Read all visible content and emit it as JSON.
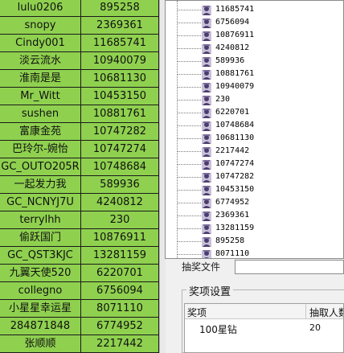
{
  "sheet": {
    "rows": [
      {
        "name": "lulu0206",
        "id": "895258"
      },
      {
        "name": "snopy",
        "id": "2369361"
      },
      {
        "name": "Cindy001",
        "id": "11685741"
      },
      {
        "name": "淡云流水",
        "id": "10940079"
      },
      {
        "name": "淮南是是",
        "id": "10681130"
      },
      {
        "name": "Mr_Witt",
        "id": "10453150"
      },
      {
        "name": "sushen",
        "id": "10881761"
      },
      {
        "name": "富康金苑",
        "id": "10747282"
      },
      {
        "name": "巴玲尔-婉怡",
        "id": "10747274"
      },
      {
        "name": "GC_OUTO205R",
        "id": "10748684"
      },
      {
        "name": "一起发力我",
        "id": "589936"
      },
      {
        "name": "GC_NCNYJ7U",
        "id": "4240812"
      },
      {
        "name": "terrylhh",
        "id": "230"
      },
      {
        "name": "偷跃国门",
        "id": "10876911"
      },
      {
        "name": "GC_QST3KJC",
        "id": "13281159"
      },
      {
        "name": "九翼天使520",
        "id": "6220701"
      },
      {
        "name": "collegno",
        "id": "6756094"
      },
      {
        "name": "小星星幸运星",
        "id": "8071110"
      },
      {
        "name": "284871848",
        "id": "6774952"
      },
      {
        "name": "张顺顺",
        "id": "2217442"
      }
    ]
  },
  "tree": {
    "items": [
      "11685741",
      "6756094",
      "10876911",
      "4240812",
      "589936",
      "10881761",
      "10940079",
      "230",
      "6220701",
      "10748684",
      "10681130",
      "2217442",
      "10747274",
      "10747282",
      "10453150",
      "6774952",
      "2369361",
      "13281159",
      "895258",
      "8071110"
    ],
    "icon": "user-icon"
  },
  "form": {
    "field_label": "抽奖文件"
  },
  "prize_group": {
    "title": "奖项设置",
    "columns": [
      "奖项",
      "抽取人数"
    ],
    "rows": [
      {
        "prize": "100星钻",
        "count": "20"
      }
    ]
  },
  "colors": {
    "sheet_green": "#8fd14f",
    "icon_purple": "#4b3d6e"
  }
}
